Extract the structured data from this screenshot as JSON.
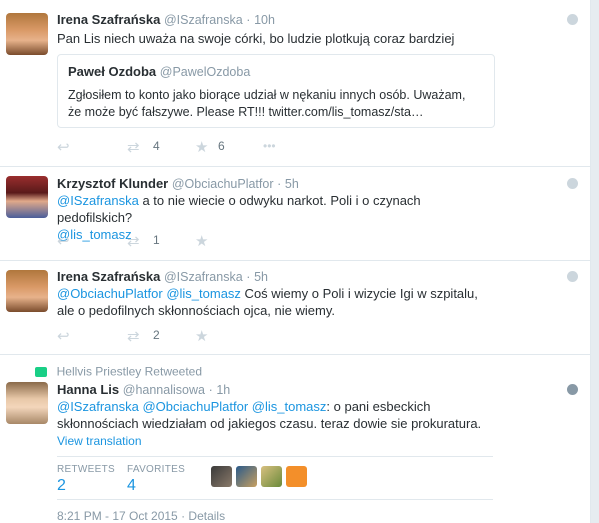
{
  "tweets": [
    {
      "name": "Irena Szafrańska",
      "handle": "@ISzafranska",
      "dot": "·",
      "time": "10h",
      "text": "Pan Lis niech uważa na swoje córki, bo ludzie plotkują coraz bardziej",
      "quote": {
        "name": "Paweł Ozdoba",
        "handle": "@PawelOzdoba",
        "text": "Zgłosiłem to konto jako biorące udział w nękaniu innych osób. Uważam, że może być fałszywe. Please RT!!! twitter.com/lis_tomasz/sta…"
      },
      "retweets": "4",
      "favorites": "6"
    },
    {
      "name": "Krzysztof Klunder",
      "handle": "@ObciachuPlatfor",
      "dot": "·",
      "time": "5h",
      "mention1": "@ISzafranska",
      "text": " a to nie wiecie o odwyku narkot. Poli i o czynach pedofilskich?",
      "mention2": "@lis_tomasz",
      "retweets": "1"
    },
    {
      "name": "Irena Szafrańska",
      "handle": "@ISzafranska",
      "dot": "·",
      "time": "5h",
      "mention1": "@ObciachuPlatfor",
      "mention2": "@lis_tomasz",
      "text": " Coś wiemy o Poli i wizycie Igi w szpitalu, ale o pedofilnych skłonnościach ojca, nie wiemy.",
      "retweets": "2"
    },
    {
      "retweeted_by": "Hellvis Priestley Retweeted",
      "name": "Hanna Lis",
      "handle": "@hannalisowa",
      "dot": "·",
      "time": "1h",
      "mention1": "@ISzafranska",
      "mention2": "@ObciachuPlatfor",
      "mention3": "@lis_tomasz",
      "text": ": o pani esbeckich skłonnościach wiedziałam od jakiegos czasu. teraz dowie sie prokuratura.",
      "view_translation": "View translation",
      "retweets_label": "RETWEETS",
      "retweets": "2",
      "favorites_label": "FAVORITES",
      "favorites": "4",
      "timestamp": "8:21 PM - 17 Oct 2015",
      "details": "Details"
    }
  ],
  "icons": {
    "reply": "↩",
    "retweet": "⇄",
    "favorite": "★",
    "more": "•••"
  },
  "colors": {
    "link": "#1b95e0",
    "muted": "#8899a6",
    "icon": "#ccd6dd",
    "retweet_green": "#19cf86"
  }
}
